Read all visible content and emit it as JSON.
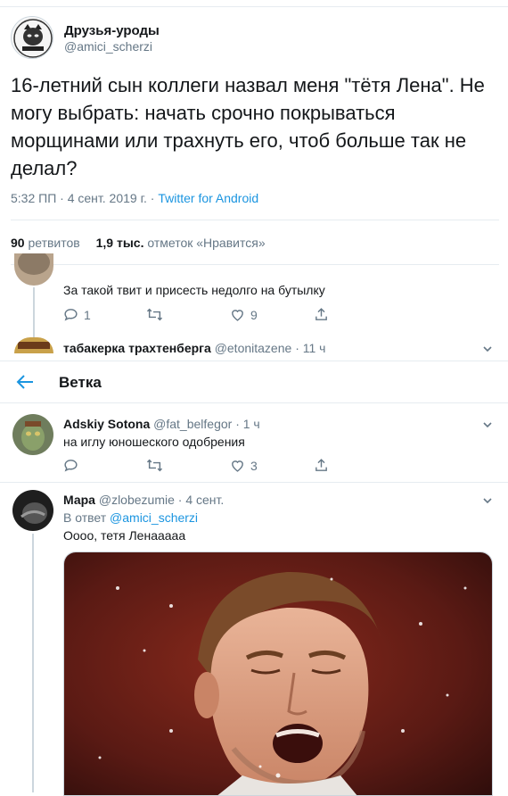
{
  "author": {
    "display_name": "Друзья-уроды",
    "handle": "@amici_scherzi"
  },
  "tweet": {
    "text": "16-летний сын коллеги назвал меня \"тётя Лена\". Не\nмогу выбрать: начать срочно покрываться\nморщинами или трахнуть его, чтоб больше так не\nделал?",
    "time": "5:32 ПП",
    "date": "4 сент. 2019 г.",
    "dot1": "·",
    "dot2": "·",
    "source": "Twitter for Android"
  },
  "stats": {
    "retweets_count": "90",
    "retweets_label": "ретвитов",
    "likes_count": "1,9 тыс.",
    "likes_label": "отметок «Нравится»"
  },
  "reply1": {
    "text": "За такой твит и присесть недолго на бутылку",
    "reply_count": "1",
    "retweet_count": "",
    "like_count": "9"
  },
  "reply2": {
    "name": "табакерка трахтенберга",
    "handle": "@etonitazene",
    "time": "· 11 ч"
  },
  "thread_header": {
    "title": "Ветка"
  },
  "reply3": {
    "name": "Adskiy Sotona",
    "handle": "@fat_belfegor",
    "time": "· 1 ч",
    "text": "на иглу юношеского одобрения",
    "reply_count": "",
    "retweet_count": "",
    "like_count": "3"
  },
  "reply4": {
    "name": "Мара",
    "handle": "@zlobezumie",
    "time": "· 4 сент.",
    "in_reply_prefix": "В ответ",
    "in_reply_handle": "@amici_scherzi",
    "text": "Оооо, тетя Ленааааа"
  },
  "colors": {
    "accent": "#1b95e0",
    "muted": "#657786",
    "border": "#e6ecf0"
  }
}
